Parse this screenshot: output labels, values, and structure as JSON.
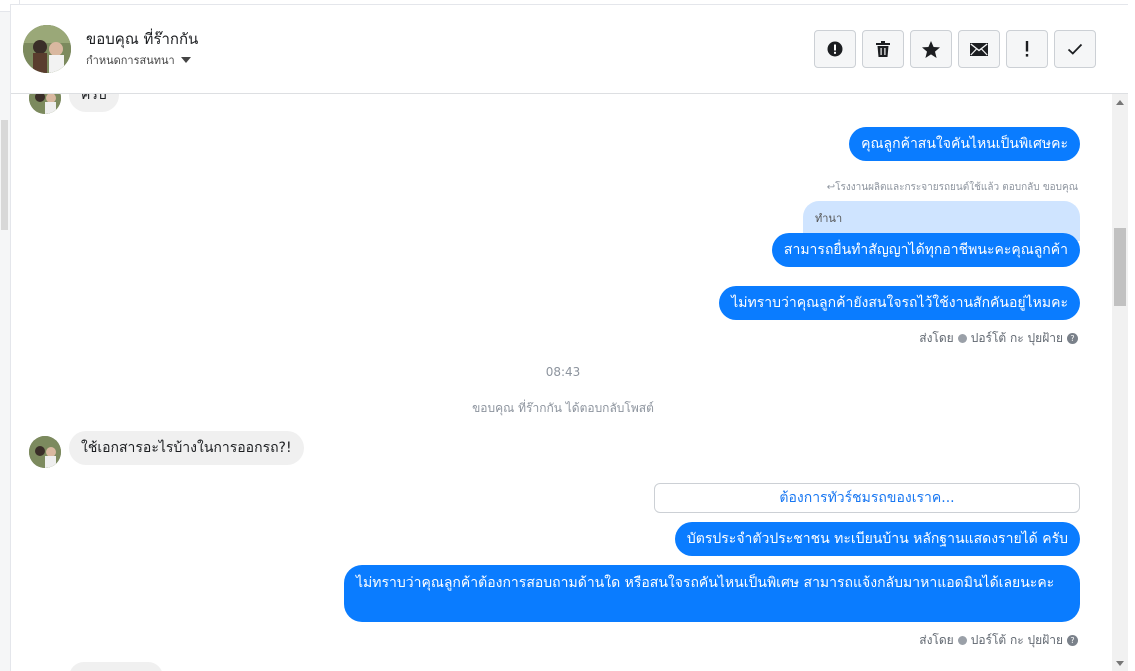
{
  "header": {
    "contact_name": "ขอบคุณ ที่ร๊ากกัน",
    "subtitle": "กำหนดการสนทนา",
    "actions": [
      {
        "name": "report-button",
        "icon": "alert-circle-icon"
      },
      {
        "name": "delete-button",
        "icon": "trash-icon"
      },
      {
        "name": "star-button",
        "icon": "star-icon"
      },
      {
        "name": "mark-unread-button",
        "icon": "envelope-icon"
      },
      {
        "name": "important-button",
        "icon": "exclamation-icon"
      },
      {
        "name": "done-button",
        "icon": "check-icon"
      }
    ]
  },
  "messages": {
    "top_in_partial": "ครับ",
    "out_1": "คุณลูกค้าสนใจคันไหนเป็นพิเศษคะ",
    "reply_meta": "↩โรงงานผลิตและกระจายรถยนต์ใช้แล้ว ตอบกลับ ขอบคุณ",
    "quoted": "ทำนา",
    "out_2": "สามารถยื่นทำสัญญาได้ทุกอาชีพนะคะคุณลูกค้า",
    "out_3": "ไม่ทราบว่าคุณลูกค้ายังสนใจรถไว้ใช้งานสักคันอยู่ไหมคะ",
    "sent_by_label": "ส่งโดย",
    "sender_name": "ปอร์โต้ กะ ปุยฝ้าย",
    "time": "08:43",
    "post_reply_notice": "ขอบคุณ ที่ร๊ากกัน ได้ตอบกลับโพสต์",
    "in_2": "ใช้เอกสารอะไรบ้างในการออกรถ?!",
    "card_button": "ต้องการทัวร์ชมรถของเราค...",
    "out_4": "บัตรประจำตัวประชาชน ทะเบียนบ้าน หลักฐานแสดงรายได้ ครับ",
    "out_5": "ไม่ทราบว่าคุณลูกค้าต้องการสอบถามด้านใด หรือสนใจรถคันไหนเป็นพิเศษ สามารถแจ้งกลับมาหาแอดมินได้เลยนะคะ"
  },
  "colors": {
    "outgoing_bubble": "#0a7cff",
    "incoming_bubble": "#f0f0f0",
    "quote_bubble": "#cfe4ff"
  }
}
